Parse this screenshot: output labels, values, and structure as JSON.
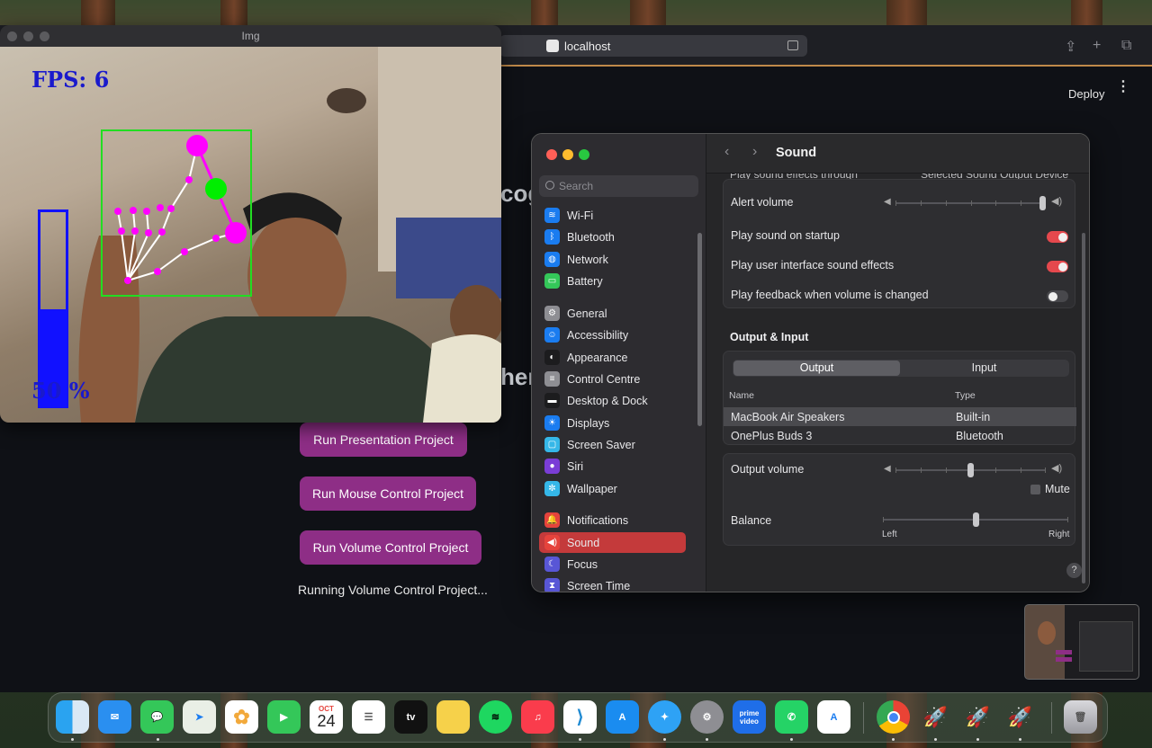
{
  "browser": {
    "url": "localhost",
    "deploy_label": "Deploy",
    "menu_glyph": "⋮",
    "partial_heading_1": "cog",
    "partial_heading_2": "her",
    "buttons": [
      "Run Presentation Project",
      "Run Mouse Control Project",
      "Run Volume Control Project"
    ],
    "status_text": "Running Volume Control Project..."
  },
  "camera_window": {
    "title": "Img",
    "fps_text": "FPS: 6",
    "volume_percent_text": "50 %",
    "volume_level": 0.5
  },
  "settings": {
    "search_placeholder": "Search",
    "sidebar": [
      {
        "label": "Wi-Fi",
        "icon": "wifi-icon",
        "color": "#1a7cf0"
      },
      {
        "label": "Bluetooth",
        "icon": "bluetooth-icon",
        "color": "#1a7cf0"
      },
      {
        "label": "Network",
        "icon": "globe-icon",
        "color": "#1a7cf0"
      },
      {
        "label": "Battery",
        "icon": "battery-icon",
        "color": "#34c759"
      },
      {
        "label": "General",
        "icon": "gear-icon",
        "color": "#8e8e93"
      },
      {
        "label": "Accessibility",
        "icon": "accessibility-icon",
        "color": "#1a7cf0"
      },
      {
        "label": "Appearance",
        "icon": "appearance-icon",
        "color": "#1c1c1e"
      },
      {
        "label": "Control Centre",
        "icon": "control-centre-icon",
        "color": "#8e8e93"
      },
      {
        "label": "Desktop & Dock",
        "icon": "desktop-icon",
        "color": "#1c1c1e"
      },
      {
        "label": "Displays",
        "icon": "sun-icon",
        "color": "#1a7cf0"
      },
      {
        "label": "Screen Saver",
        "icon": "screen-saver-icon",
        "color": "#35b7e8"
      },
      {
        "label": "Siri",
        "icon": "siri-icon",
        "color": "#7a3dd6"
      },
      {
        "label": "Wallpaper",
        "icon": "snowflake-icon",
        "color": "#35b7e8"
      },
      {
        "label": "Notifications",
        "icon": "bell-icon",
        "color": "#e5433c"
      },
      {
        "label": "Sound",
        "icon": "speaker-icon",
        "color": "#e5433c"
      },
      {
        "label": "Focus",
        "icon": "moon-icon",
        "color": "#5856d6"
      },
      {
        "label": "Screen Time",
        "icon": "hourglass-icon",
        "color": "#5856d6"
      }
    ],
    "title": "Sound",
    "partial_row": "Play sound effects through",
    "partial_row_value": "Selected Sound Output Device",
    "alert_volume_label": "Alert volume",
    "alert_volume_level": 1.0,
    "toggles": [
      {
        "label": "Play sound on startup",
        "on": true
      },
      {
        "label": "Play user interface sound effects",
        "on": true
      },
      {
        "label": "Play feedback when volume is changed",
        "on": false
      }
    ],
    "output_input_heading": "Output & Input",
    "tabs": {
      "output": "Output",
      "input": "Input"
    },
    "table": {
      "headers": {
        "name": "Name",
        "type": "Type"
      },
      "rows": [
        {
          "name": "MacBook Air Speakers",
          "type": "Built-in"
        },
        {
          "name": "OnePlus Buds 3",
          "type": "Bluetooth"
        }
      ]
    },
    "output_volume_label": "Output volume",
    "output_volume_level": 0.5,
    "mute_label": "Mute",
    "balance_label": "Balance",
    "balance_level": 0.5,
    "balance_left": "Left",
    "balance_right": "Right",
    "help_glyph": "?"
  },
  "dock": {
    "calendar_month": "OCT",
    "calendar_day": "24",
    "apps": [
      "finder-icon",
      "mail-icon",
      "messages-icon",
      "maps-icon",
      "photos-icon",
      "facetime-icon",
      "calendar-icon",
      "reminders-icon",
      "tv-icon",
      "notes-icon",
      "spotify-icon",
      "music-icon",
      "vscode-icon",
      "app-store-icon",
      "safari-icon",
      "system-settings-icon",
      "prime-video-icon",
      "whatsapp-icon",
      "xcode-icon",
      "chrome-icon",
      "rocket-icon",
      "rocket-icon",
      "rocket-icon",
      "trash-icon"
    ],
    "tv_label": "tv",
    "prime_label": "prime video"
  }
}
